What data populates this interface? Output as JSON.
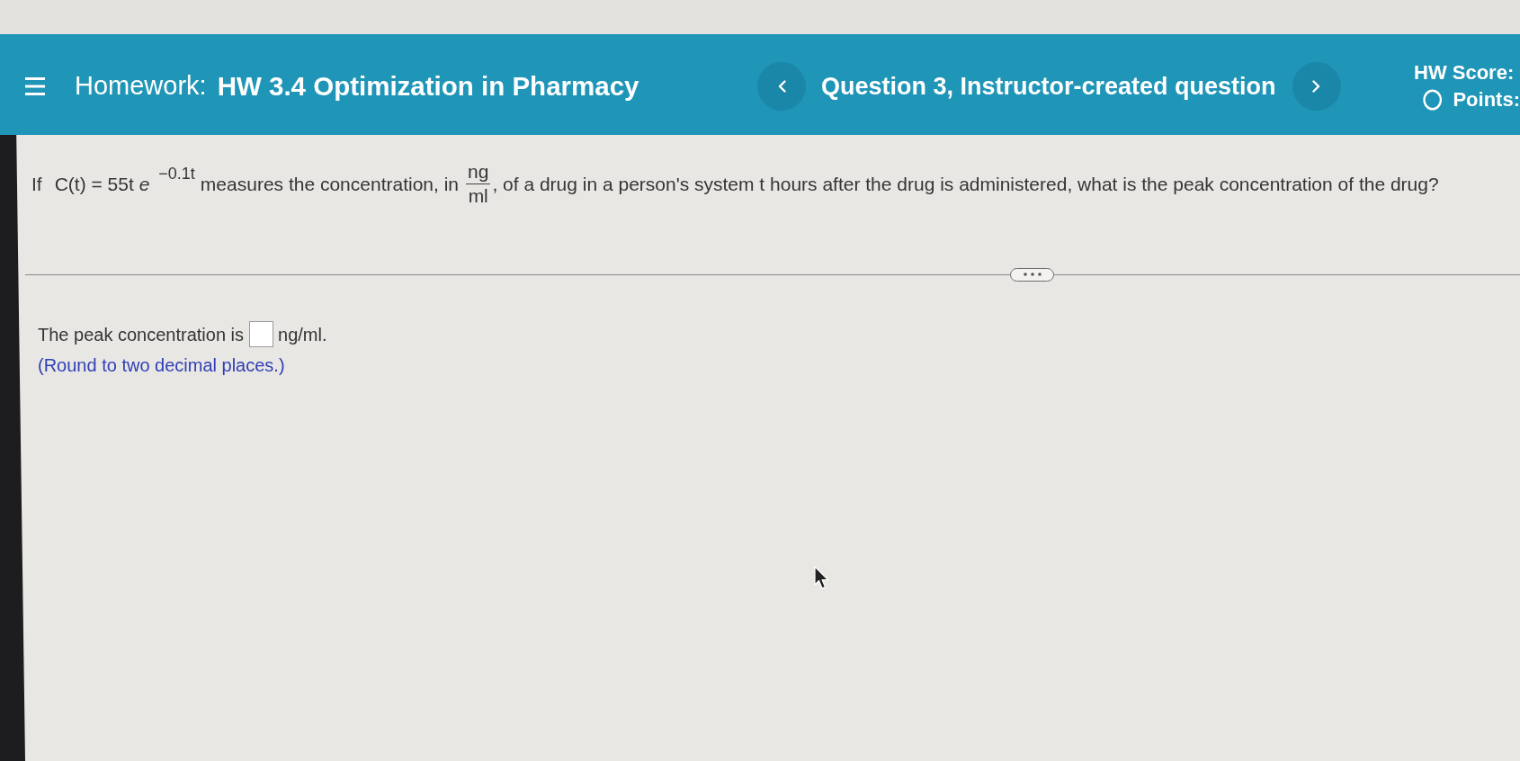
{
  "header": {
    "label": "Homework:",
    "title": "HW 3.4 Optimization in Pharmacy",
    "question_title": "Question 3, Instructor-created question",
    "score_label": "HW Score:",
    "points_label": "Points:"
  },
  "question": {
    "lead": "If",
    "formula": "C(t) = 55t *e*$^{−0.1t}$",
    "text_before_unit": "measures the concentration, in",
    "unit_numerator": "ng",
    "unit_denominator": "ml",
    "text_after_unit": ", of a drug in a person's system t hours after the drug is administered, what is the peak concentration of the drug?"
  },
  "answer": {
    "prefix": "The peak concentration is",
    "suffix": "ng/ml.",
    "hint": "(Round to two decimal places.)"
  }
}
